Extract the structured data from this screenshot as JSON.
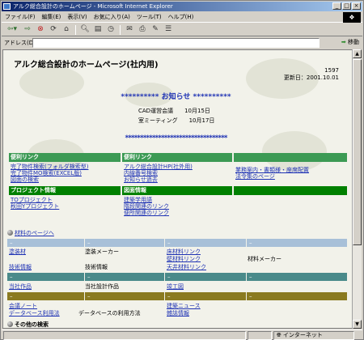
{
  "window": {
    "title": "アルク総合設計のホームページ - Microsoft Internet Explorer",
    "buttons": [
      "_",
      "□",
      "×"
    ]
  },
  "menu": {
    "items": [
      "ファイル(F)",
      "編集(E)",
      "表示(V)",
      "お気に入り(A)",
      "ツール(T)",
      "ヘルプ(H)"
    ]
  },
  "toolbar": {
    "buttons": [
      "back-icon",
      "forward-icon",
      "stop-icon",
      "refresh-icon",
      "home-icon",
      "search-icon",
      "favorites-icon",
      "history-icon",
      "mail-icon",
      "print-icon",
      "edit-icon",
      "discuss-icon"
    ]
  },
  "address": {
    "label": "アドレス(D)",
    "value": "",
    "go_label": "移動"
  },
  "page": {
    "title": "アルク総合設計のホームページ(社内用)",
    "counter": "1597",
    "updated": "更新日：2001.10.01",
    "notice": "********** お知らせ **********",
    "meetings": [
      {
        "name": "CAD運営会議",
        "date": "10月15日"
      },
      {
        "name": "室ミーティング",
        "date": "10月17日"
      }
    ],
    "stars": "**********************************"
  },
  "sections": {
    "links1": {
      "header": "便利リンク",
      "items": [
        "完了物件検索(フォルダ検索型)",
        "完了物件MO検索(EXCEL版)",
        "図面の検索"
      ]
    },
    "links2": {
      "header": "便利リンク",
      "items": [
        "アルク総合設計HP(社外用)",
        "内線番号検索",
        "お知らせ過去"
      ]
    },
    "links3": {
      "items": [
        "業務案内・書類様・座席配置",
        "法令集のページ"
      ]
    },
    "project": {
      "header": "プロジェクト情報",
      "items": [
        "TOプロジェクト",
        "秋田Yプロジェクト"
      ]
    },
    "drawing": {
      "header": "図面情報",
      "items": [
        "建築学用語",
        "階段関連のリンク",
        "便所関連のリンク"
      ]
    }
  },
  "materials": {
    "label": "材料のページへ",
    "rows": [
      {
        "left_link": "塗装材",
        "left_text": "塗装メーカー",
        "right_link": "床材料リンク",
        "right_text": ""
      },
      {
        "left_link": "",
        "left_text": "",
        "right_link": "壁材料リンク",
        "right_text": "材料メーカー"
      },
      {
        "left_link": "技術情報",
        "left_text": "技術情報",
        "right_link": "天井材料リンク",
        "right_text": ""
      },
      {
        "left_link": "当社作品",
        "left_text": "当社設計作品",
        "right_link": "竣工図",
        "right_text": ""
      },
      {
        "left_link": "会議ノート",
        "left_text": "",
        "right_link": "建築ニュース",
        "right_text": ""
      },
      {
        "left_link": "データベース利用法",
        "left_text": "データベースの利用方法",
        "right_link": "雑誌情報",
        "right_text": ""
      }
    ]
  },
  "footer": {
    "other_search": "その他の検索"
  },
  "status": {
    "zone": "インターネット"
  },
  "colors": {
    "link": "#1e32b4",
    "section_green": "#3c9a54",
    "section_dark_green": "#008000",
    "band_blue": "#a8c0d8",
    "band_teal": "#4a8a8a",
    "band_olive": "#8a7a20"
  }
}
